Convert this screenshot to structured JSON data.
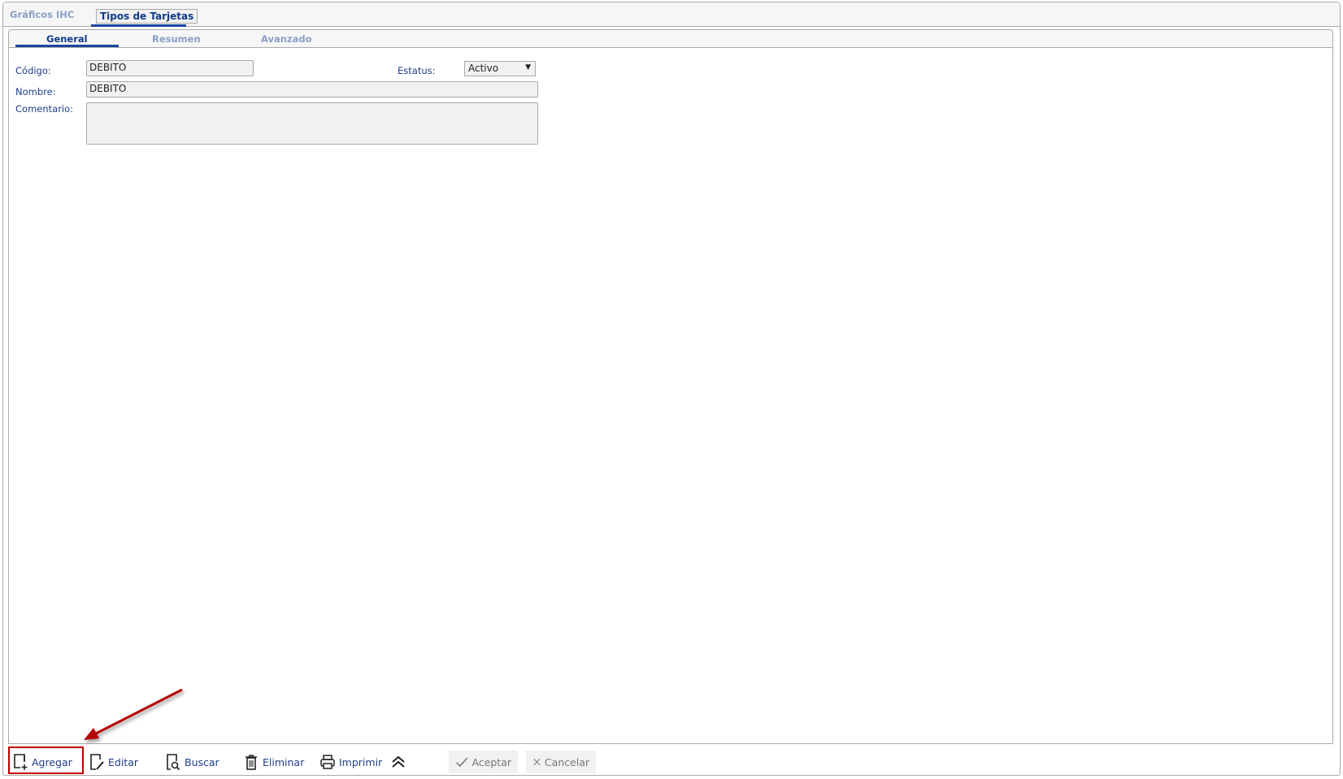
{
  "top_tabs": [
    {
      "label": "Gráficos IHC",
      "selected": false
    },
    {
      "label": "Tipos de Tarjetas",
      "selected": true
    }
  ],
  "sub_tabs": [
    {
      "label": "General",
      "selected": true
    },
    {
      "label": "Resumen",
      "selected": false
    },
    {
      "label": "Avanzado",
      "selected": false
    }
  ],
  "form": {
    "codigo_label": "Código:",
    "codigo_value": "DEBITO",
    "estatus_label": "Estatus:",
    "estatus_value": "Activo",
    "nombre_label": "Nombre:",
    "nombre_value": "DEBITO",
    "comentario_label": "Comentario:",
    "comentario_value": ""
  },
  "toolbar": {
    "agregar": "Agregar",
    "editar": "Editar",
    "buscar": "Buscar",
    "eliminar": "Eliminar",
    "imprimir": "Imprimir",
    "aceptar": "Aceptar",
    "cancelar": "Cancelar"
  },
  "colors": {
    "accent": "#1b47a0",
    "highlight": "#c00000"
  }
}
